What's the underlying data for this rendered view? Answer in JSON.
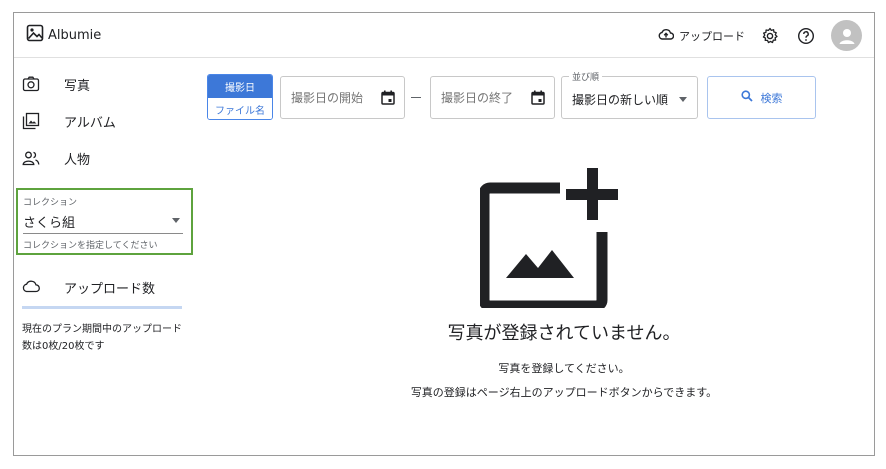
{
  "app": {
    "name": "Albumie"
  },
  "header": {
    "upload_label": "アップロード",
    "icons": [
      "cloud-upload-icon",
      "gear-icon",
      "help-icon",
      "account-icon"
    ]
  },
  "sidebar": {
    "items": [
      {
        "label": "写真",
        "icon": "camera-icon"
      },
      {
        "label": "アルバム",
        "icon": "photo-library-icon"
      },
      {
        "label": "人物",
        "icon": "people-icon"
      }
    ],
    "collection": {
      "label": "コレクション",
      "value": "さくら組",
      "helper": "コレクションを指定してください"
    },
    "upload_count": {
      "label": "アップロード数",
      "icon": "cloud-icon",
      "note": "現在のプラン期間中のアップロード数は0枚/20枚です",
      "used": 0,
      "limit": 20
    }
  },
  "search": {
    "toggle_active": "撮影日",
    "toggle_inactive": "ファイル名",
    "start_placeholder": "撮影日の開始",
    "end_placeholder": "撮影日の終了",
    "sort_label": "並び順",
    "sort_value": "撮影日の新しい順",
    "search_button": "検索"
  },
  "empty_state": {
    "title": "写真が登録されていません。",
    "line1": "写真を登録してください。",
    "line2": "写真の登録はページ右上のアップロードボタンからできます。"
  },
  "colors": {
    "accent": "#3d78d8",
    "highlight_border": "#5ea33e",
    "avatar": "#c1c1c1"
  }
}
